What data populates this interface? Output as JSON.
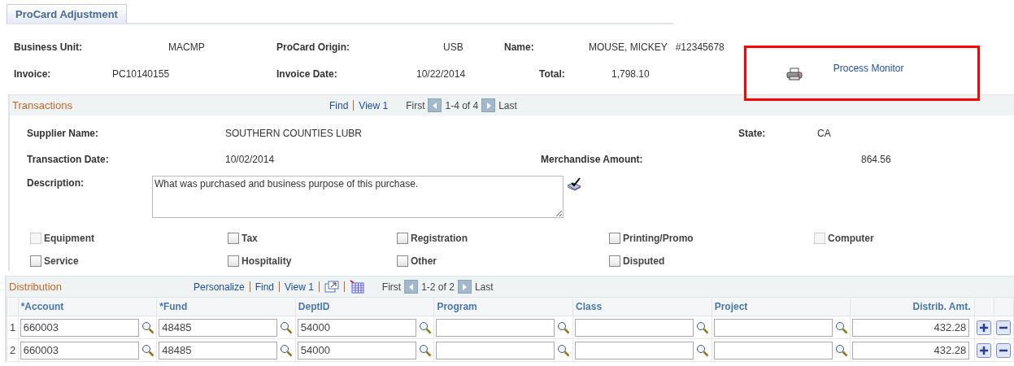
{
  "tab": {
    "label": "ProCard Adjustment",
    "selected": true
  },
  "header_rows": [
    [
      {
        "label": "Business Unit:",
        "value": "MACMP"
      },
      {
        "label": "ProCard Origin:",
        "value": "USB"
      },
      {
        "label": "Name:",
        "value": "MOUSE, MICKEY",
        "extra": "#12345678"
      }
    ],
    [
      {
        "label": "Invoice:",
        "value": "PC10140155"
      },
      {
        "label": "Invoice Date:",
        "value": "10/22/2014"
      },
      {
        "label": "Total:",
        "value": "1,798.10"
      }
    ]
  ],
  "process_monitor": {
    "label": "Process Monitor",
    "highlighted": true
  },
  "transactions": {
    "title": "Transactions",
    "find": "Find",
    "view": "View 1",
    "first": "First",
    "range": "1-4 of 4",
    "last": "Last",
    "field_rows": [
      [
        {
          "label": "Supplier Name:",
          "value": "SOUTHERN COUNTIES LUBR"
        },
        {
          "label": "State:",
          "value": "CA"
        }
      ],
      [
        {
          "label": "Transaction Date:",
          "value": "10/02/2014"
        },
        {
          "label": "Merchandise Amount:",
          "value": "864.56"
        }
      ]
    ],
    "description": {
      "label": "Description:",
      "value": "What was purchased and business purpose of this purchase."
    },
    "categories": [
      {
        "label": "Equipment",
        "checked": false,
        "disabled": true
      },
      {
        "label": "Tax",
        "checked": false,
        "disabled": false
      },
      {
        "label": "Registration",
        "checked": false,
        "disabled": false
      },
      {
        "label": "Printing/Promo",
        "checked": false,
        "disabled": false
      },
      {
        "label": "Computer",
        "checked": false,
        "disabled": true
      },
      {
        "label": "Service",
        "checked": false,
        "disabled": false
      },
      {
        "label": "Hospitality",
        "checked": false,
        "disabled": false
      },
      {
        "label": "Other",
        "checked": false,
        "disabled": false
      },
      {
        "label": "Disputed",
        "checked": false,
        "disabled": false
      }
    ]
  },
  "distribution": {
    "title": "Distribution",
    "personalize": "Personalize",
    "find": "Find",
    "view": "View 1",
    "first": "First",
    "range": "1-2 of 2",
    "last": "Last",
    "columns": [
      "*Account",
      "*Fund",
      "DeptID",
      "Program",
      "Class",
      "Project",
      "Distrib. Amt."
    ],
    "rows": [
      {
        "number": "1",
        "values": [
          "660003",
          "48485",
          "54000"
        ],
        "amount": "432.28"
      },
      {
        "number": "2",
        "values": [
          "660003",
          "48485",
          "54000"
        ],
        "amount": "432.28"
      }
    ]
  }
}
